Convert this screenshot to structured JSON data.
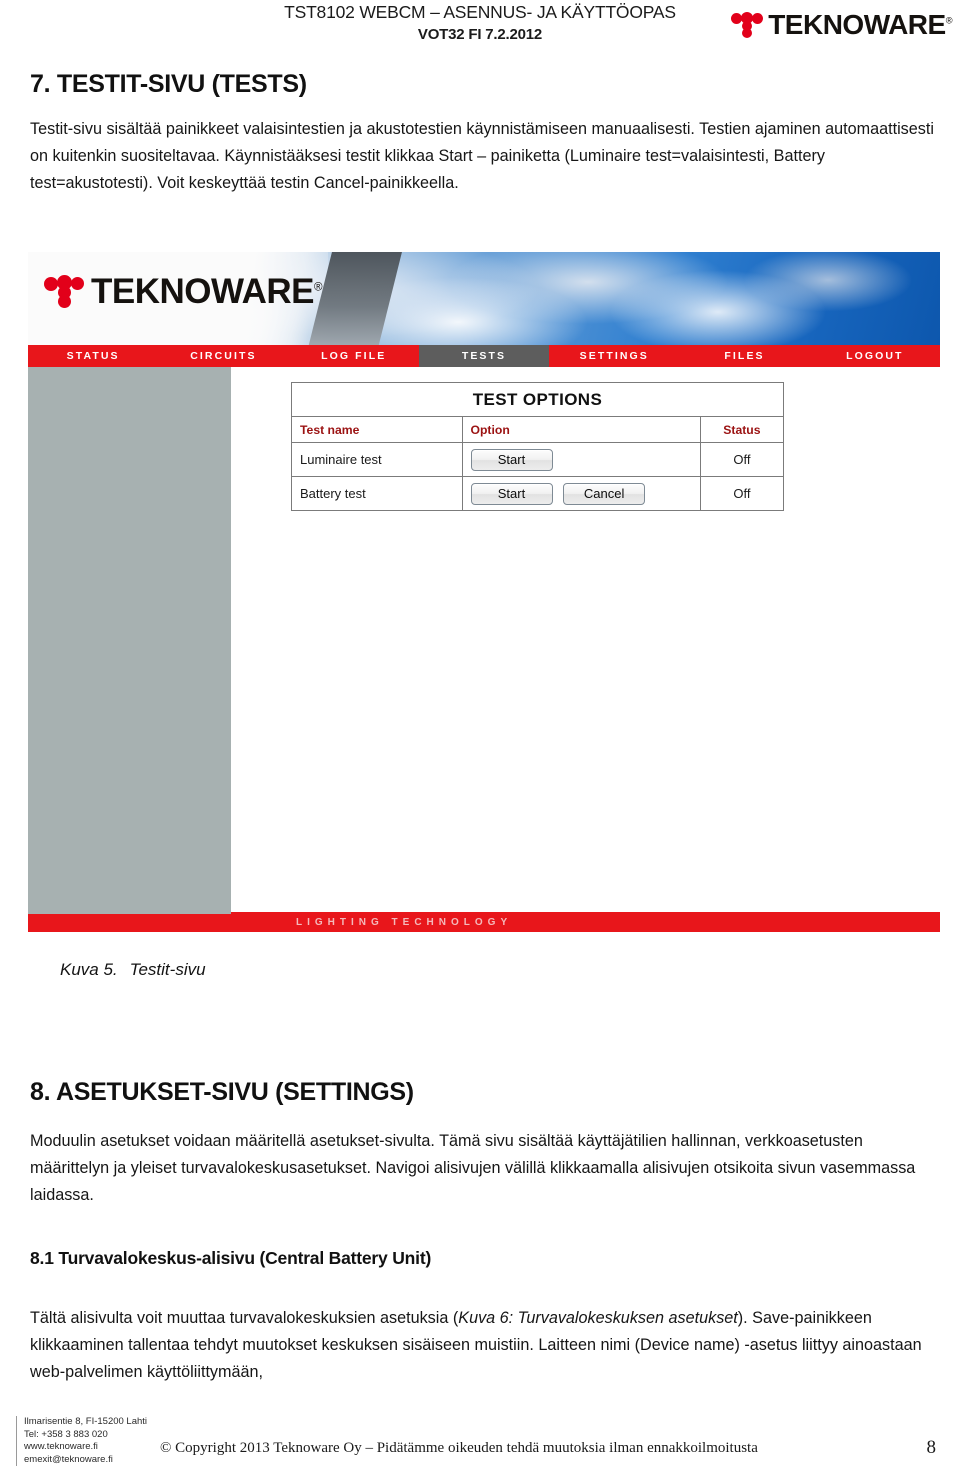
{
  "header": {
    "doc_title": "TST8102 WEBCM – ASENNUS- JA KÄYTTÖOPAS",
    "doc_subtitle": "VOT32 FI 7.2.2012",
    "logo_word": "TEKNOWARE",
    "logo_registered": "®"
  },
  "section7": {
    "heading": "7. TESTIT-SIVU (TESTS)",
    "paragraph": "Testit-sivu sisältää painikkeet valaisintestien ja akustotestien käynnistämiseen manuaalisesti. Testien ajaminen automaattisesti on kuitenkin suositeltavaa. Käynnistääksesi testit klikkaa Start – painiketta (Luminaire test=valaisintesti, Battery test=akustotesti). Voit keskeyttää testin Cancel-painikkeella."
  },
  "screenshot": {
    "logo_word": "TEKNOWARE",
    "logo_registered": "®",
    "nav": [
      {
        "label": "STATUS",
        "active": false
      },
      {
        "label": "CIRCUITS",
        "active": false
      },
      {
        "label": "LOG FILE",
        "active": false
      },
      {
        "label": "TESTS",
        "active": true
      },
      {
        "label": "SETTINGS",
        "active": false
      },
      {
        "label": "FILES",
        "active": false
      },
      {
        "label": "LOGOUT",
        "active": false
      }
    ],
    "table": {
      "title": "TEST OPTIONS",
      "columns": [
        "Test name",
        "Option",
        "Status"
      ],
      "rows": [
        {
          "name": "Luminaire test",
          "buttons": [
            "Start"
          ],
          "status": "Off"
        },
        {
          "name": "Battery test",
          "buttons": [
            "Start",
            "Cancel"
          ],
          "status": "Off"
        }
      ]
    },
    "footer_tagline": "LIGHTING TECHNOLOGY",
    "colors": {
      "nav_red": "#e8161b",
      "nav_active_gray": "#5d5d5d",
      "sidebar_gray": "#a7b1b1",
      "header_red_text": "#9b1212",
      "brand_red": "#e2001a"
    }
  },
  "caption": {
    "number": "Kuva 5.",
    "text": "Testit-sivu"
  },
  "section8": {
    "heading": "8. ASETUKSET-SIVU (SETTINGS)",
    "paragraph": "Moduulin asetukset voidaan määritellä asetukset-sivulta. Tämä sivu sisältää käyttäjätilien hallinnan, verkkoasetusten määrittelyn ja yleiset turvavalokeskusasetukset. Navigoi alisivujen välillä klikkaamalla alisivujen otsikoita sivun vasemmassa laidassa."
  },
  "section81": {
    "heading": "8.1 Turvavalokeskus-alisivu (Central Battery Unit)",
    "paragraph_part1": "Tältä alisivulta voit muuttaa turvavalokeskuksien asetuksia (",
    "paragraph_italic": "Kuva 6: Turvavalokeskuksen asetukset",
    "paragraph_part2": "). Save-painikkeen klikkaaminen tallentaa tehdyt muutokset keskuksen sisäiseen muistiin. Laitteen nimi (Device name) -asetus liittyy ainoastaan web-palvelimen käyttöliittymään,"
  },
  "page_footer": {
    "address_line1": "Ilmarisentie 8, FI-15200 Lahti",
    "address_line2": "Tel: +358 3 883 020",
    "address_line3": "www.teknoware.fi",
    "address_line4": "emexit@teknoware.fi",
    "copyright": "© Copyright 2013 Teknoware Oy – Pidätämme oikeuden tehdä muutoksia ilman ennakkoilmoitusta",
    "page_number": "8"
  }
}
